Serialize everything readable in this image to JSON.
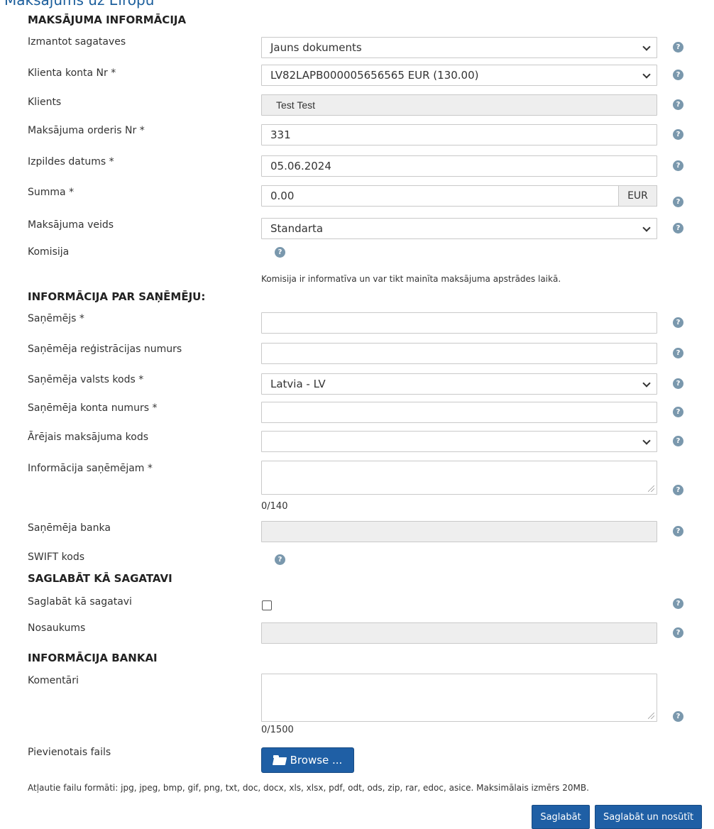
{
  "page": {
    "title": "Maksājums uz Eiropu"
  },
  "sections": {
    "payment_info": "MAKSĀJUMA INFORMĀCIJA",
    "beneficiary_info": "INFORMĀCIJA PAR SAŅĒMĒJU:",
    "save_template": "SAGLABĀT KĀ SAGATAVI",
    "bank_info": "INFORMĀCIJA BANKAI"
  },
  "fields": {
    "template": {
      "label": "Izmantot sagataves",
      "value": "Jauns dokuments"
    },
    "account": {
      "label": "Klienta konta Nr *",
      "value": "LV82LAPB000005656565 EUR (130.00)"
    },
    "client": {
      "label": "Klients",
      "value": "Test Test"
    },
    "order_no": {
      "label": "Maksājuma orderis Nr *",
      "value": "331"
    },
    "exec_date": {
      "label": "Izpildes datums *",
      "value": "05.06.2024"
    },
    "amount": {
      "label": "Summa *",
      "value": "0.00",
      "currency": "EUR"
    },
    "payment_type": {
      "label": "Maksājuma veids",
      "value": "Standarta"
    },
    "commission": {
      "label": "Komisija",
      "note": "Komisija ir informatīva un var tikt mainīta maksājuma apstrādes laikā."
    },
    "beneficiary": {
      "label": "Saņēmējs *",
      "value": ""
    },
    "reg_no": {
      "label": "Saņēmēja reģistrācijas numurs",
      "value": ""
    },
    "country": {
      "label": "Saņēmēja valsts kods *",
      "value": "Latvia - LV"
    },
    "ben_account": {
      "label": "Saņēmēja konta numurs *",
      "value": ""
    },
    "ext_code": {
      "label": "Ārējais maksājuma kods",
      "value": ""
    },
    "ben_info": {
      "label": "Informācija saņēmējam *",
      "value": "",
      "counter": "0/140"
    },
    "ben_bank": {
      "label": "Saņēmēja banka",
      "value": ""
    },
    "swift": {
      "label": "SWIFT kods"
    },
    "save_as_template": {
      "label": "Saglabāt kā sagatavi",
      "checked": false
    },
    "template_name": {
      "label": "Nosaukums",
      "value": ""
    },
    "comments": {
      "label": "Komentāri",
      "value": "",
      "counter": "0/1500"
    },
    "attachment": {
      "label": "Pievienotais fails",
      "button": "Browse ...",
      "formats": "Atļautie failu formāti: jpg, jpeg, bmp, gif, png, txt, doc, docx, xls, xlsx, pdf, odt, ods, zip, rar, edoc, asice. Maksimālais izmērs 20MB."
    }
  },
  "help_glyph": "?",
  "icons": {
    "help": "question-circle-icon",
    "folder": "folder-open-icon",
    "dropdown": "chevron-down-icon"
  },
  "colors": {
    "primary": "#1f5fa5",
    "help": "#7a98ad",
    "disabled_bg": "#eeeeee"
  },
  "actions": {
    "save": "Saglabāt",
    "save_send": "Saglabāt un nosūtīt"
  }
}
